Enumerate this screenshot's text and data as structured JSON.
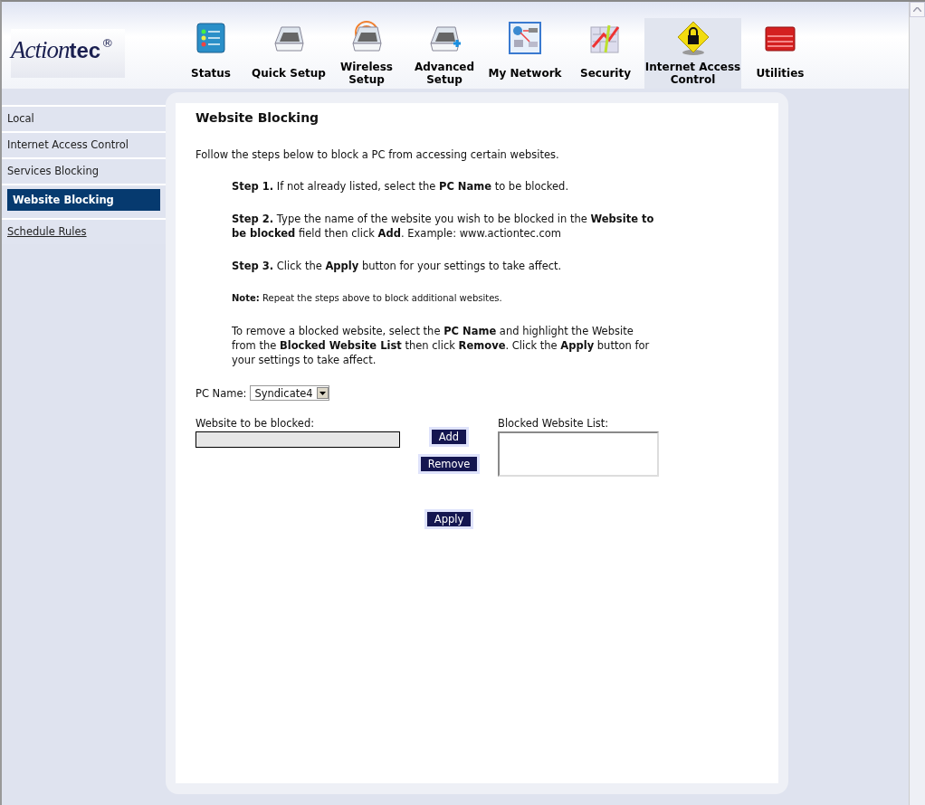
{
  "logo": {
    "script": "Action",
    "bold": "tec",
    "mark": "®"
  },
  "nav": [
    {
      "label": "Status",
      "kind": "status",
      "selected": false
    },
    {
      "label": "Quick Setup",
      "kind": "router",
      "selected": false
    },
    {
      "label": "Wireless Setup",
      "kind": "wireless",
      "selected": false
    },
    {
      "label": "Advanced Setup",
      "kind": "advanced",
      "selected": false
    },
    {
      "label": "My Network",
      "kind": "network",
      "selected": false
    },
    {
      "label": "Security",
      "kind": "security",
      "selected": false
    },
    {
      "label": "Internet Access Control",
      "kind": "lock",
      "selected": true
    },
    {
      "label": "Utilities",
      "kind": "toolbox",
      "selected": false
    }
  ],
  "sidebar": {
    "items": [
      {
        "label": "Local",
        "selected": false,
        "kind": "item"
      },
      {
        "label": "Internet Access Control",
        "selected": false,
        "kind": "item"
      },
      {
        "label": "Services Blocking",
        "selected": false,
        "kind": "item"
      },
      {
        "label": "Website Blocking",
        "selected": true,
        "kind": "item"
      },
      {
        "label": "Schedule Rules",
        "selected": false,
        "kind": "link"
      }
    ]
  },
  "content": {
    "title": "Website Blocking",
    "intro": "Follow the steps below to block a PC from accessing certain websites.",
    "steps": [
      {
        "kind": "step",
        "text": "**Step 1.** If not already listed, select the **PC Name** to be blocked."
      },
      {
        "kind": "step",
        "text": "**Step 2.** Type the name of the website you wish to be blocked in the **Website to be blocked** field then click **Add**. Example: www.actiontec.com"
      },
      {
        "kind": "step",
        "text": "**Step 3.** Click the **Apply** button for your settings to take affect."
      },
      {
        "kind": "note",
        "text": "**Note:** Repeat the steps above to block additional websites."
      },
      {
        "kind": "step",
        "text": "To remove a blocked website, select the **PC Name** and highlight the Website from the **Blocked Website List** then click **Remove**. Click the **Apply** button for your settings to take affect."
      }
    ],
    "pc_name": {
      "label": "PC Name:",
      "value": "Syndicate4"
    },
    "website_field": {
      "label": "Website to be blocked:",
      "disabled": true
    },
    "blocked_list": {
      "label": "Blocked Website List:"
    },
    "buttons": {
      "add": "Add",
      "remove": "Remove",
      "apply": "Apply"
    }
  }
}
